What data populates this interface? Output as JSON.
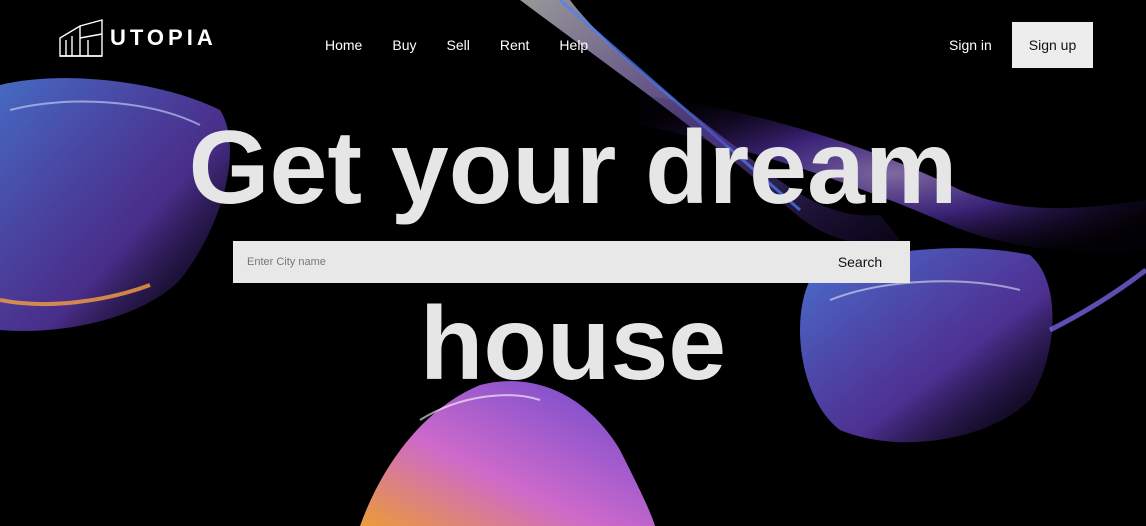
{
  "brand": {
    "name": "UTOPIA",
    "logo_icon": "building-outline-icon"
  },
  "nav": {
    "items": [
      {
        "label": "Home"
      },
      {
        "label": "Buy"
      },
      {
        "label": "Sell"
      },
      {
        "label": "Rent"
      },
      {
        "label": "Help"
      }
    ]
  },
  "auth": {
    "signin_label": "Sign in",
    "signup_label": "Sign up"
  },
  "hero": {
    "headline_line1": "Get your dream",
    "headline_line2": "house"
  },
  "search": {
    "placeholder": "Enter City name",
    "value": "",
    "button_label": "Search"
  },
  "colors": {
    "background": "#000000",
    "headline": "#e6e6e6",
    "searchbar": "#e8e8e8",
    "signup_bg": "#ededed",
    "accent_purple": "#8a5cf6",
    "accent_orange": "#f4a340"
  }
}
